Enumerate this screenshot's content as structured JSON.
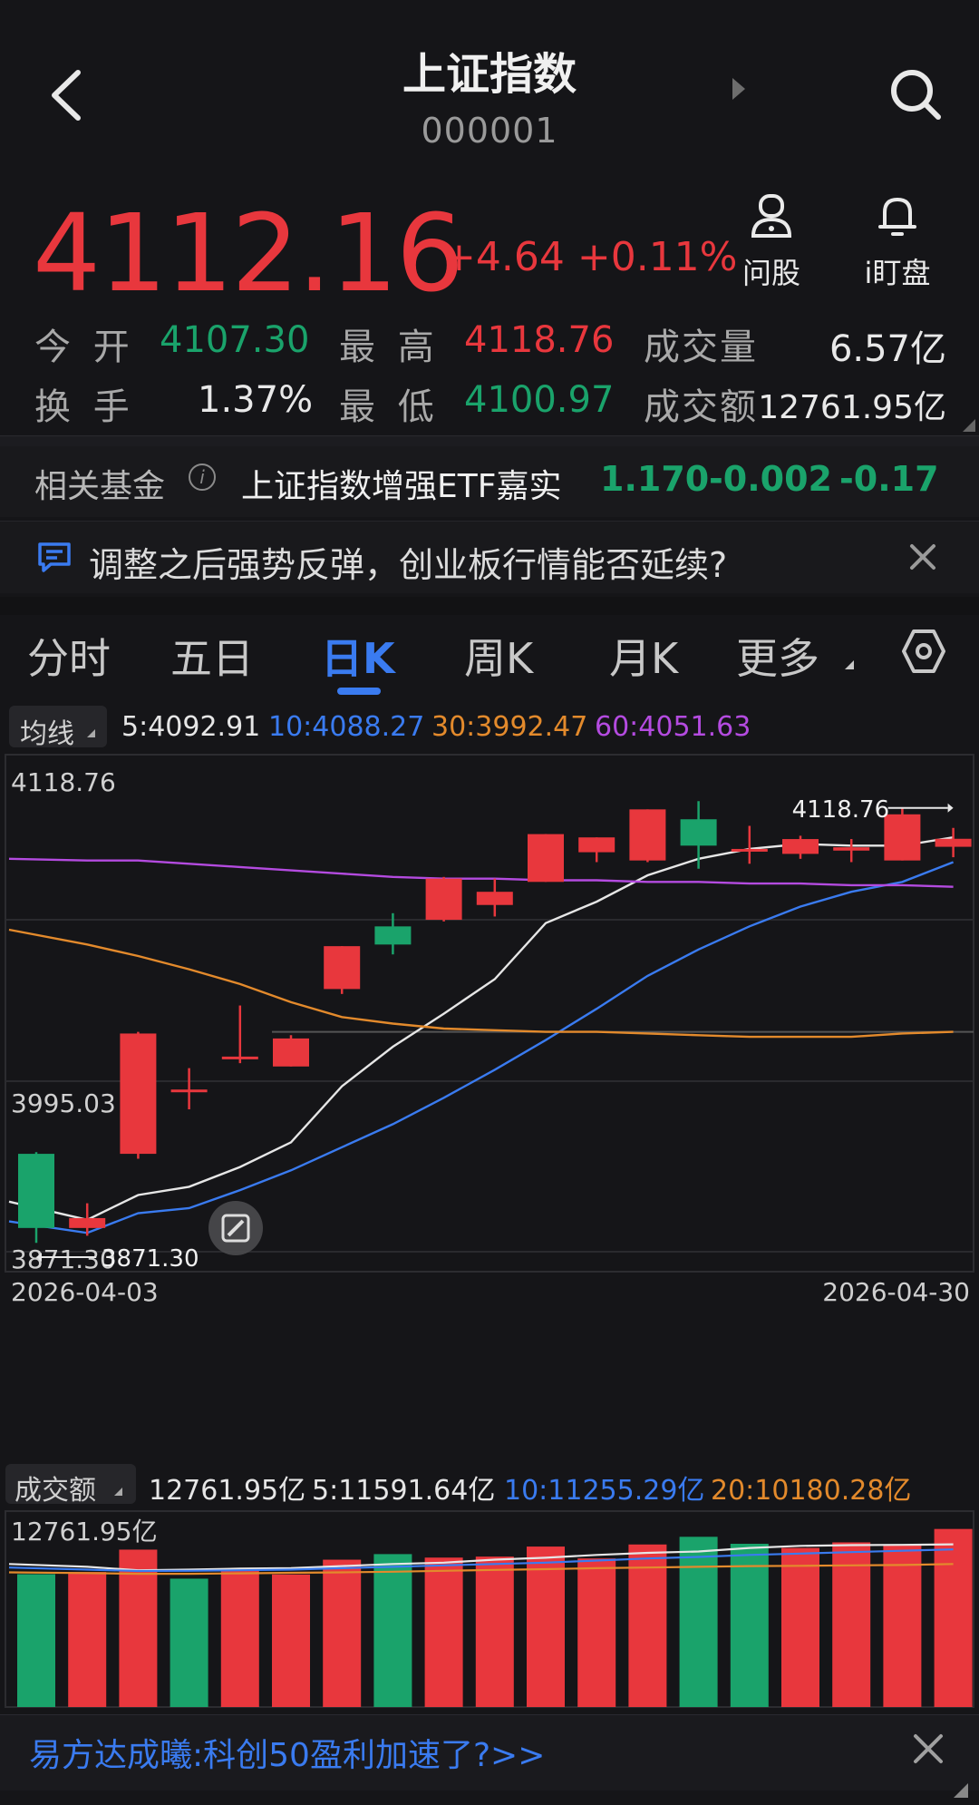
{
  "header": {
    "title": "上证指数",
    "code": "000001"
  },
  "quote": {
    "price": "4112.16",
    "change": "+4.64",
    "change_pct": "+0.11%",
    "actions": [
      {
        "label": "问股",
        "icon": "robot-advisor-icon"
      },
      {
        "label": "i盯盘",
        "icon": "bell-icon"
      }
    ]
  },
  "stats": {
    "open_label": "今 开",
    "open": "4107.30",
    "high_label": "最 高",
    "high": "4118.76",
    "volume_label": "成交量",
    "volume": "6.57亿",
    "turnover_label": "换 手",
    "turnover": "1.37%",
    "low_label": "最 低",
    "low": "4100.97",
    "amount_label": "成交额",
    "amount": "12761.95亿"
  },
  "fund": {
    "label": "相关基金",
    "name": "上证指数增强ETF嘉实",
    "price": "1.170",
    "change": "-0.002",
    "change_pct": "-0.17"
  },
  "news": {
    "text": "调整之后强势反弹，创业板行情能否延续?"
  },
  "tabs": [
    {
      "label": "分时"
    },
    {
      "label": "五日"
    },
    {
      "label": "日K",
      "active": true
    },
    {
      "label": "周K"
    },
    {
      "label": "月K"
    },
    {
      "label": "更多"
    }
  ],
  "ma_bar": {
    "button": "均线",
    "ma5": "5:4092.91",
    "ma10": "10:4088.27",
    "ma30": "30:3992.47",
    "ma60": "60:4051.63"
  },
  "colors": {
    "up": "#e8373d",
    "down": "#1aa36b",
    "ma5": "#e6e6e6",
    "ma10": "#3a7bf0",
    "ma30": "#e38a2c",
    "ma60": "#b44be0",
    "accent": "#3a7bf0"
  },
  "chart_data": [
    {
      "type": "candlestick",
      "y_axis_labels": [
        "4118.76",
        "3995.03",
        "3871.30"
      ],
      "ylim": [
        3871.3,
        4118.76
      ],
      "x_labels": [
        "2026-04-03",
        "2026-04-30"
      ],
      "high_marker": "4118.76",
      "low_marker": "3871.30",
      "candles": [
        {
          "o": 3921,
          "c": 3876,
          "h": 3922,
          "l": 3867
        },
        {
          "o": 3876,
          "c": 3882,
          "h": 3891,
          "l": 3871.3
        },
        {
          "o": 3921,
          "c": 3994,
          "h": 3995,
          "l": 3918
        },
        {
          "o": 3960,
          "c": 3960,
          "h": 3973,
          "l": 3948
        },
        {
          "o": 3979,
          "c": 3980,
          "h": 4011,
          "l": 3976
        },
        {
          "o": 3974,
          "c": 3991,
          "h": 3993,
          "l": 3974
        },
        {
          "o": 4021,
          "c": 4047,
          "h": 4047,
          "l": 4018
        },
        {
          "o": 4059,
          "c": 4048,
          "h": 4067,
          "l": 4042
        },
        {
          "o": 4063,
          "c": 4088,
          "h": 4089,
          "l": 4062
        },
        {
          "o": 4072,
          "c": 4080,
          "h": 4088,
          "l": 4065
        },
        {
          "o": 4086,
          "c": 4115,
          "h": 4115,
          "l": 4086
        },
        {
          "o": 4104,
          "c": 4113,
          "h": 4113,
          "l": 4098
        },
        {
          "o": 4099,
          "c": 4130,
          "h": 4130,
          "l": 4098
        },
        {
          "o": 4124,
          "c": 4108,
          "h": 4135,
          "l": 4094
        },
        {
          "o": 4106,
          "c": 4106,
          "h": 4120,
          "l": 4097
        },
        {
          "o": 4103,
          "c": 4112,
          "h": 4114,
          "l": 4100
        },
        {
          "o": 4105,
          "c": 4107,
          "h": 4112,
          "l": 4098
        },
        {
          "o": 4099,
          "c": 4127,
          "h": 4131,
          "l": 4099
        },
        {
          "o": 4107.3,
          "c": 4112.16,
          "h": 4118.76,
          "l": 4100.97
        }
      ],
      "ma": [
        {
          "name": "5",
          "values": [
            3892,
            3881,
            3896,
            3901,
            3913,
            3928,
            3962,
            3986,
            4006,
            4027,
            4061,
            4074,
            4090,
            4100,
            4106,
            4109,
            4108,
            4108,
            4113
          ]
        },
        {
          "name": "10",
          "values": [
            3880,
            3873,
            3885,
            3888,
            3899,
            3911,
            3925,
            3939,
            3955,
            3972,
            3990,
            4009,
            4029,
            4045,
            4059,
            4071,
            4080,
            4086,
            4098
          ]
        },
        {
          "name": "30",
          "values": [
            4057,
            4048,
            4041,
            4033,
            4024,
            4013,
            4004,
            4000,
            3997,
            3996,
            3995,
            3995,
            3994,
            3993,
            3992,
            3992,
            3992,
            3994,
            3995
          ]
        },
        {
          "name": "60",
          "values": [
            4100,
            4099,
            4099,
            4097,
            4095,
            4093,
            4091,
            4089,
            4088,
            4088,
            4087,
            4087,
            4086,
            4086,
            4085,
            4085,
            4084,
            4084,
            4083
          ]
        }
      ]
    },
    {
      "type": "bar",
      "title": "成交额",
      "top_label": "12761.95亿",
      "current": "12761.95亿",
      "ma5_label": "5:11591.64亿",
      "ma10_label": "10:11255.29亿",
      "ma20_label": "20:10180.28亿",
      "values": [
        9520,
        9680,
        11280,
        9200,
        9930,
        9500,
        10560,
        10960,
        10710,
        10780,
        11500,
        10650,
        11650,
        12200,
        11700,
        11400,
        11800,
        11600,
        12762
      ],
      "directions": [
        "down",
        "up",
        "up",
        "down",
        "up",
        "up",
        "up",
        "down",
        "up",
        "up",
        "up",
        "up",
        "up",
        "down",
        "down",
        "up",
        "up",
        "up",
        "up"
      ],
      "ma": [
        {
          "name": "5",
          "values": [
            10250,
            10050,
            9800,
            9850,
            9920,
            9950,
            10100,
            10250,
            10350,
            10560,
            10700,
            10900,
            11050,
            11150,
            11400,
            11550,
            11600,
            11620,
            11660
          ]
        },
        {
          "name": "10",
          "values": [
            10000,
            9850,
            9750,
            9760,
            9800,
            9850,
            9950,
            10050,
            10150,
            10250,
            10350,
            10500,
            10650,
            10760,
            10900,
            11000,
            11100,
            11200,
            11300
          ]
        },
        {
          "name": "20",
          "values": [
            9650,
            9600,
            9550,
            9550,
            9580,
            9620,
            9650,
            9700,
            9760,
            9830,
            9880,
            9950,
            10000,
            10050,
            10100,
            10120,
            10150,
            10180,
            10250
          ]
        }
      ]
    }
  ],
  "bottom_banner": {
    "text": "易方达成曦:科创50盈利加速了?>>"
  }
}
